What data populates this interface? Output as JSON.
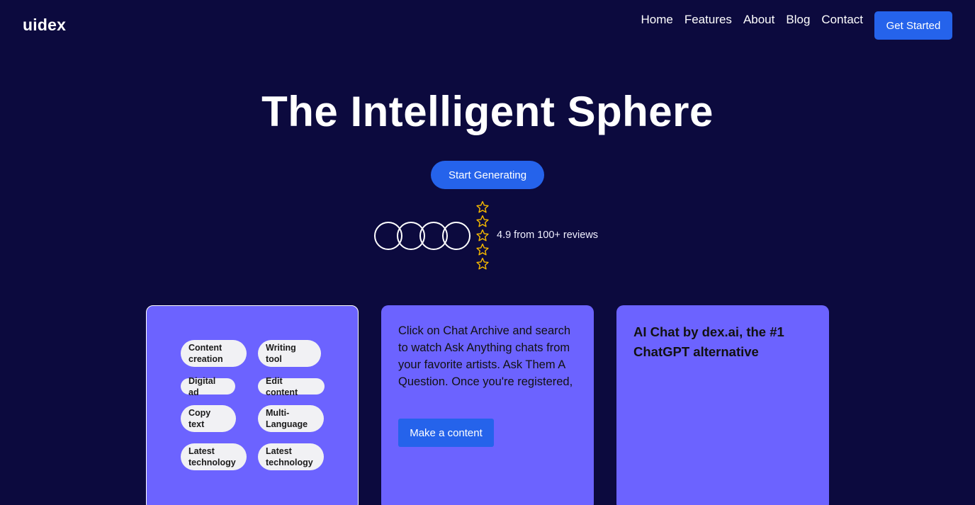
{
  "brand": {
    "logo": "uidex"
  },
  "nav": {
    "items": [
      "Home",
      "Features",
      "About",
      "Blog",
      "Contact"
    ],
    "cta": "Get Started"
  },
  "hero": {
    "title": "The Intelligent Sphere",
    "button": "Start Generating"
  },
  "reviews": {
    "avatar_count": 4,
    "star_count": 5,
    "star_icon": "star-outline-icon",
    "text": "4.9 from 100+ reviews"
  },
  "cards": {
    "tags": [
      "Content creation",
      "Writing tool",
      "Digital ad",
      "Edit content",
      "Copy text",
      "Multi-Language",
      "Latest technology",
      "Latest technology"
    ],
    "middle": {
      "text": "Click on Chat Archive and search to watch Ask Anything chats from your favorite artists. Ask Them A Question. Once you're registered,",
      "button": "Make a content"
    },
    "right": {
      "title": "AI Chat by dex.ai, the #1 ChatGPT alternative"
    }
  },
  "colors": {
    "background": "#0c0a3e",
    "accent": "#2563eb",
    "card": "#6c63ff",
    "star": "#f5b800"
  }
}
